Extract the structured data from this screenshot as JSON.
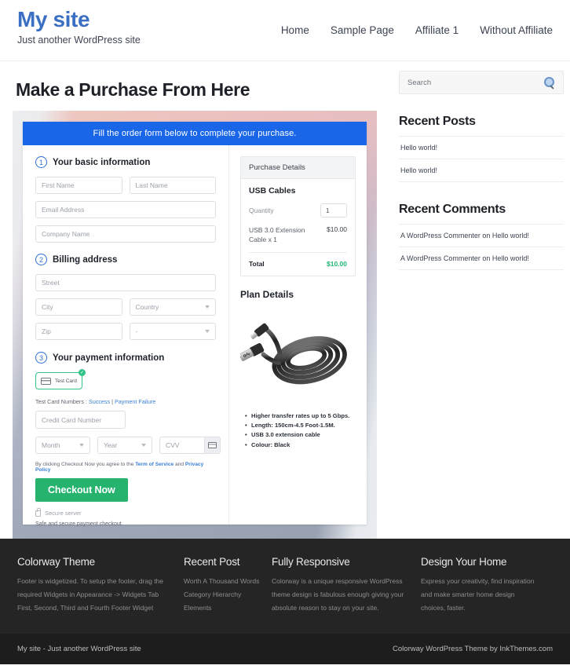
{
  "header": {
    "site_title": "My site",
    "tagline": "Just another WordPress site",
    "nav": [
      {
        "label": "Home"
      },
      {
        "label": "Sample Page"
      },
      {
        "label": "Affiliate 1"
      },
      {
        "label": "Without Affiliate"
      }
    ]
  },
  "page": {
    "title": "Make a Purchase From Here"
  },
  "order_form": {
    "banner": "Fill the order form below to complete your purchase.",
    "steps": {
      "basic": {
        "number": "1",
        "label": "Your basic information"
      },
      "billing": {
        "number": "2",
        "label": "Billing address"
      },
      "payment": {
        "number": "3",
        "label": "Your payment information"
      }
    },
    "fields": {
      "first_name": "First Name",
      "last_name": "Last Name",
      "email": "Email Address",
      "company": "Company Name",
      "street": "Street",
      "city": "City",
      "country": "Country",
      "zip": "Zip",
      "state": "-",
      "credit_card": "Credit Card Number",
      "month": "Month",
      "year": "Year",
      "cvv": "CVV"
    },
    "payment_method": {
      "label": "Test Card"
    },
    "test_card_prefix": "Test Card Numbers : ",
    "test_card_success": "Success",
    "test_card_separator": " | ",
    "test_card_failure": "Payment Failure",
    "terms_prefix": "By clicking Checkout Now you agree to the ",
    "terms_tos": "Term of Service",
    "terms_and": " and ",
    "terms_privacy": "Privacy Policy",
    "checkout_button": "Checkout Now",
    "secure_server": "Secure server",
    "safe_note": "Safe and secure payment checkout."
  },
  "purchase_details": {
    "header": "Purchase Details",
    "product_name": "USB Cables",
    "quantity_label": "Quantity",
    "quantity_value": "1",
    "line_item_desc": "USB 3.0 Extension Cable x 1",
    "line_item_amount": "$10.00",
    "total_label": "Total",
    "total_amount": "$10.00"
  },
  "plan_details": {
    "title": "Plan Details",
    "bullets": [
      "Higher transfer rates up to 5 Gbps.",
      "Length: 150cm-4.5 Foot-1.5M.",
      "USB 3.0 extension cable",
      "Colour: Black"
    ]
  },
  "sidebar": {
    "search_placeholder": "Search",
    "recent_posts_title": "Recent Posts",
    "recent_posts": [
      {
        "label": "Hello world!"
      },
      {
        "label": "Hello world!"
      }
    ],
    "recent_comments_title": "Recent Comments",
    "recent_comments": [
      {
        "label": "A WordPress Commenter on Hello world!"
      },
      {
        "label": "A WordPress Commenter on Hello world!"
      }
    ]
  },
  "footer": {
    "col1": {
      "title": "Colorway Theme",
      "text": "Footer is widgetized. To setup the footer, drag the required Widgets in Appearance -> Widgets Tab First, Second, Third and Fourth Footer Widget"
    },
    "col2": {
      "title": "Recent Post",
      "items": [
        {
          "label": "Worth A Thousand Words"
        },
        {
          "label": "Category Hierarchy"
        },
        {
          "label": "Elements"
        }
      ]
    },
    "col3": {
      "title": "Fully Responsive",
      "text": "Colorway is a unique responsive WordPress theme design is fabulous enough giving your absolute reason to stay on your site."
    },
    "col4": {
      "title": "Design Your Home",
      "text": "Express your creativity, find inspiration and make smarter home design choices, faster."
    },
    "bottom_left": "My site - Just another WordPress site",
    "bottom_right": "Colorway WordPress Theme by InkThemes.com"
  },
  "colors": {
    "brand_blue": "#3b6fc4",
    "banner_blue": "#1a66e8",
    "checkout_green": "#26b36e",
    "total_green": "#22b573",
    "link_blue": "#3a7fd5",
    "footer_dark": "#252525",
    "footer_darker": "#1d1d1d"
  }
}
